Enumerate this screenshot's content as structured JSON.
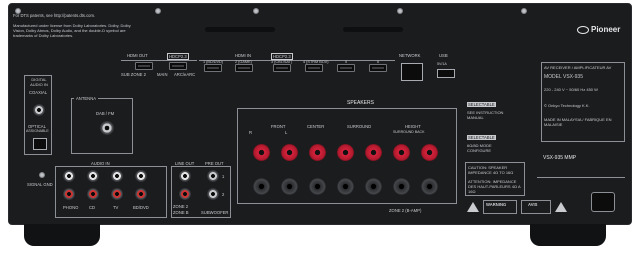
{
  "header_notes": {
    "patents": "For DTS patents, see http://patents.dts.com.",
    "dolby": "Manufactured under license from Dolby Laboratories. Dolby, Dolby Vision, Dolby Atmos, Dolby Audio, and the double-D symbol are trademarks of Dolby Laboratories."
  },
  "brand": "Pioneer",
  "hdmi_out": {
    "label": "HDMI OUT",
    "hdcp": "HDCP2.3",
    "sub": "SUB ZONE 2",
    "main": "MAIN",
    "arc": "ARC/eARC"
  },
  "hdmi_in": {
    "label": "HDMI IN",
    "hdcp": "HDCP2.3",
    "ports": [
      "1 (BD/DVD)",
      "2 (GAME)",
      "3 (CBL/SAT)",
      "4 (STRM BOX)",
      "5",
      "6"
    ]
  },
  "network": "NETWORK",
  "usb": {
    "label": "USB",
    "power": "5V/1A"
  },
  "digital_audio_in": {
    "title": "DIGITAL AUDIO IN",
    "coaxial": "COAXIAL",
    "optical": "OPTICAL",
    "assignable": "ASSIGNABLE"
  },
  "antenna": {
    "title": "ANTENNA",
    "band": "DAB / FM"
  },
  "speakers": {
    "title": "SPEAKERS",
    "groups": [
      "FRONT",
      "CENTER",
      "SURROUND",
      "HEIGHT"
    ],
    "height_sub": "SURROUND BACK",
    "zone": "ZONE 2 (B-AMP)",
    "rl": [
      "R",
      "L"
    ]
  },
  "audio_in": {
    "title": "AUDIO IN",
    "signal_gnd": "SIGNAL GND",
    "phono": "PHONO",
    "inputs": [
      "CD",
      "TV",
      "BD/DVD"
    ]
  },
  "line_out": {
    "title": "LINE OUT",
    "zone2": "ZONE 2",
    "zoneb": "ZONE B"
  },
  "pre_out": {
    "title": "PRE OUT",
    "sub": "SUBWOOFER",
    "ch": [
      "1",
      "2"
    ]
  },
  "selectable": {
    "tag": "SELECTABLE",
    "text": "SEE INSTRUCTION MANUAL"
  },
  "selectable2": {
    "tag": "SELECTABLE",
    "text": "6Ω/8Ω MODE CONFIGURE"
  },
  "caution": "CAUTION: SPEAKER IMPEDANCE 4Ω TO 16Ω",
  "attention": "ATTENTION: IMPEDANCE DES HAUT-PARLEURS 4Ω A 16Ω",
  "label": {
    "model_title": "AV RECEIVER / AMPLIFICATEUR AV",
    "model_line": "MODEL VSX-935",
    "power": "220 - 240 V ~ 50/60 Hz 450 W",
    "maker": "© Onkyo Technology K.K.",
    "origin": "MADE IN MALAYSIA / FABRIQUE EN MALAISIE"
  },
  "model_badge": "VSX-935 MMP",
  "warnings": [
    "WARNING",
    "AVIS"
  ]
}
